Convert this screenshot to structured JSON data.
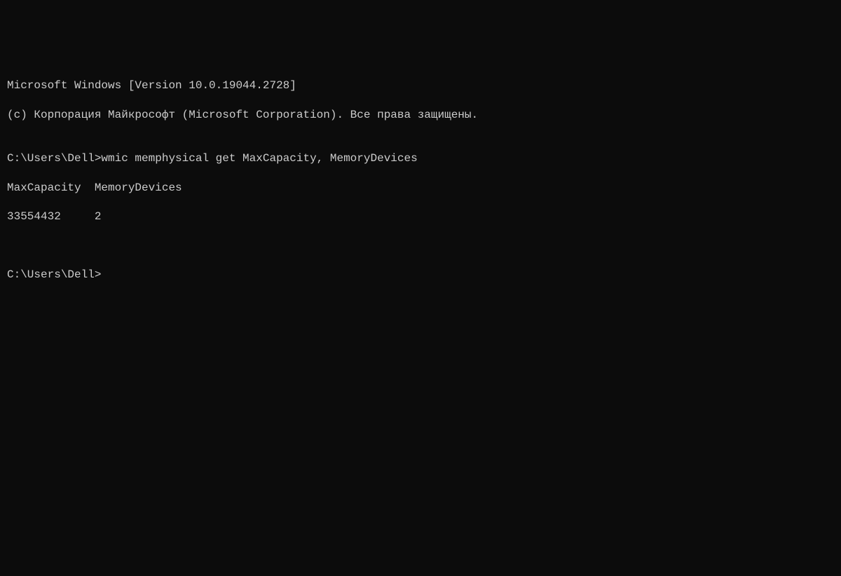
{
  "terminal": {
    "header_line1": "Microsoft Windows [Version 10.0.19044.2728]",
    "header_line2": "(c) Корпорация Майкрософт (Microsoft Corporation). Все права защищены.",
    "blank1": "",
    "prompt1_path": "C:\\Users\\Dell>",
    "prompt1_command": "wmic memphysical get MaxCapacity, MemoryDevices",
    "output_headers": "MaxCapacity  MemoryDevices",
    "output_values": "33554432     2",
    "blank2": "",
    "blank3": "",
    "prompt2_path": "C:\\Users\\Dell>",
    "prompt2_command": ""
  }
}
